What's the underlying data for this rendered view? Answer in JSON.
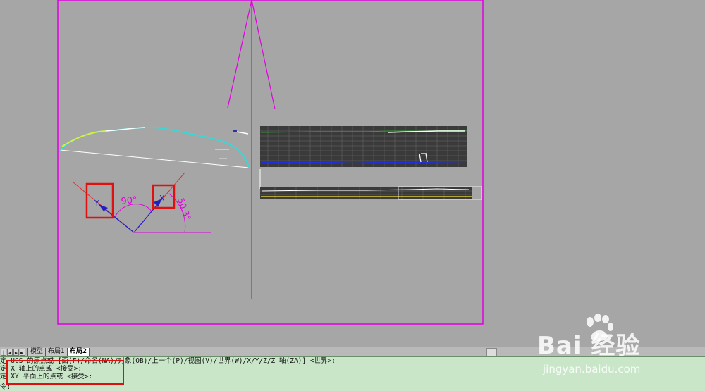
{
  "tabs": {
    "nav": [
      "|◀",
      "◀",
      "▶",
      "▶|"
    ],
    "items": [
      "模型",
      "布局1",
      "布局2"
    ],
    "active_index": 2
  },
  "command": {
    "lines": [
      "定 UCS 的原点或 [面(F)/命名(NA)/对象(OB)/上一个(P)/视图(V)/世界(W)/X/Y/Z/Z 轴(ZA)] <世界>:",
      "定 X 轴上的点或 <接受>:",
      "定 XY 平面上的点或 <接受>:"
    ],
    "prompt": "令:"
  },
  "drawing": {
    "angle_90": "90°",
    "angle_50": "50.3°",
    "axis_y": "Y",
    "axis_x": "X"
  },
  "watermark": {
    "logo": "Bai 经验",
    "url": "jingyan.baidu.com"
  },
  "colors": {
    "viewport_border": "#e000e0",
    "command_bg": "#c9e6c9",
    "highlight": "#e01010"
  }
}
